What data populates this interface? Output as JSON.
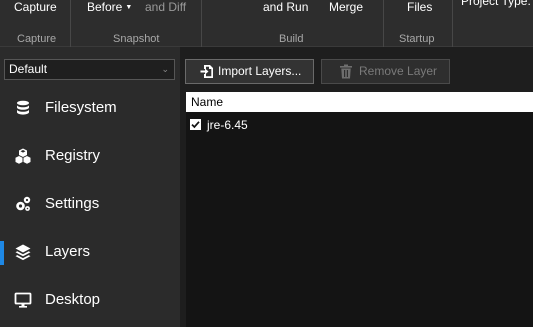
{
  "ribbon": {
    "buttons": {
      "capture": "Capture",
      "before": "Before",
      "and_diff": "and Diff",
      "and_run": "and Run",
      "merge": "Merge",
      "files": "Files",
      "project_type": "Project Type:"
    },
    "groups": {
      "capture": "Capture",
      "snapshot": "Snapshot",
      "build": "Build",
      "startup": "Startup"
    }
  },
  "sidebar": {
    "dropdown_value": "Default",
    "items": [
      {
        "label": "Filesystem",
        "icon": "database-icon"
      },
      {
        "label": "Registry",
        "icon": "cubes-icon"
      },
      {
        "label": "Settings",
        "icon": "gears-icon"
      },
      {
        "label": "Layers",
        "icon": "layers-icon",
        "active": true
      },
      {
        "label": "Desktop",
        "icon": "monitor-icon"
      }
    ]
  },
  "toolbar": {
    "import_label": "Import Layers...",
    "remove_label": "Remove Layer"
  },
  "list": {
    "header": "Name",
    "rows": [
      {
        "label": "jre-6.45",
        "checked": true
      }
    ]
  },
  "colors": {
    "accent": "#1e88e5",
    "ribbon_bg": "#2d2d2d",
    "sidebar_bg": "#2b2b2b",
    "content_bg": "#141414"
  }
}
